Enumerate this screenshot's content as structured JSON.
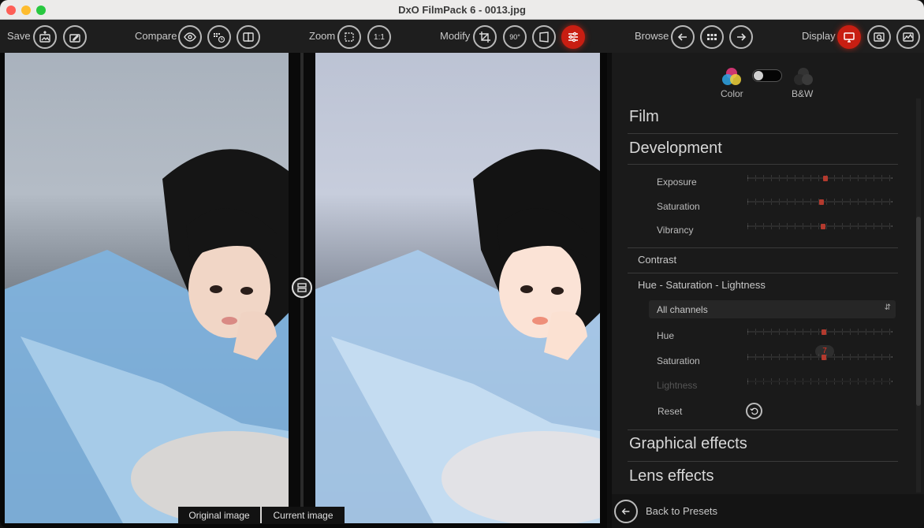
{
  "window": {
    "title": "DxO FilmPack 6 - 0013.jpg"
  },
  "toolbar": {
    "save_label": "Save",
    "compare_label": "Compare",
    "zoom_label": "Zoom",
    "zoom_1to1": "1:1",
    "modify_label": "Modify",
    "rotate_label": "90°",
    "browse_label": "Browse",
    "display_label": "Display"
  },
  "viewer": {
    "original_caption": "Original image",
    "current_caption": "Current image"
  },
  "panel": {
    "mode": {
      "color_label": "Color",
      "bw_label": "B&W",
      "bw_enabled": false
    },
    "sections": {
      "film": "Film",
      "development": "Development",
      "contrast": "Contrast",
      "hsl": "Hue - Saturation - Lightness",
      "graphical_effects": "Graphical effects",
      "lens_effects": "Lens effects"
    },
    "development": {
      "exposure_label": "Exposure",
      "exposure_level": 0.54,
      "saturation_label": "Saturation",
      "saturation_level": 0.51,
      "vibrancy_label": "Vibrancy",
      "vibrancy_level": 0.52
    },
    "hsl": {
      "channel_selected": "All channels",
      "hue_label": "Hue",
      "hue_level": 0.53,
      "saturation_label": "Saturation",
      "saturation_value": "7",
      "saturation_level": 0.53,
      "lightness_label": "Lightness",
      "lightness_level": 0.5,
      "reset_label": "Reset"
    },
    "footer": {
      "back_label": "Back to Presets"
    }
  },
  "colors": {
    "accent": "#c81e12",
    "value_red": "#e53323"
  }
}
